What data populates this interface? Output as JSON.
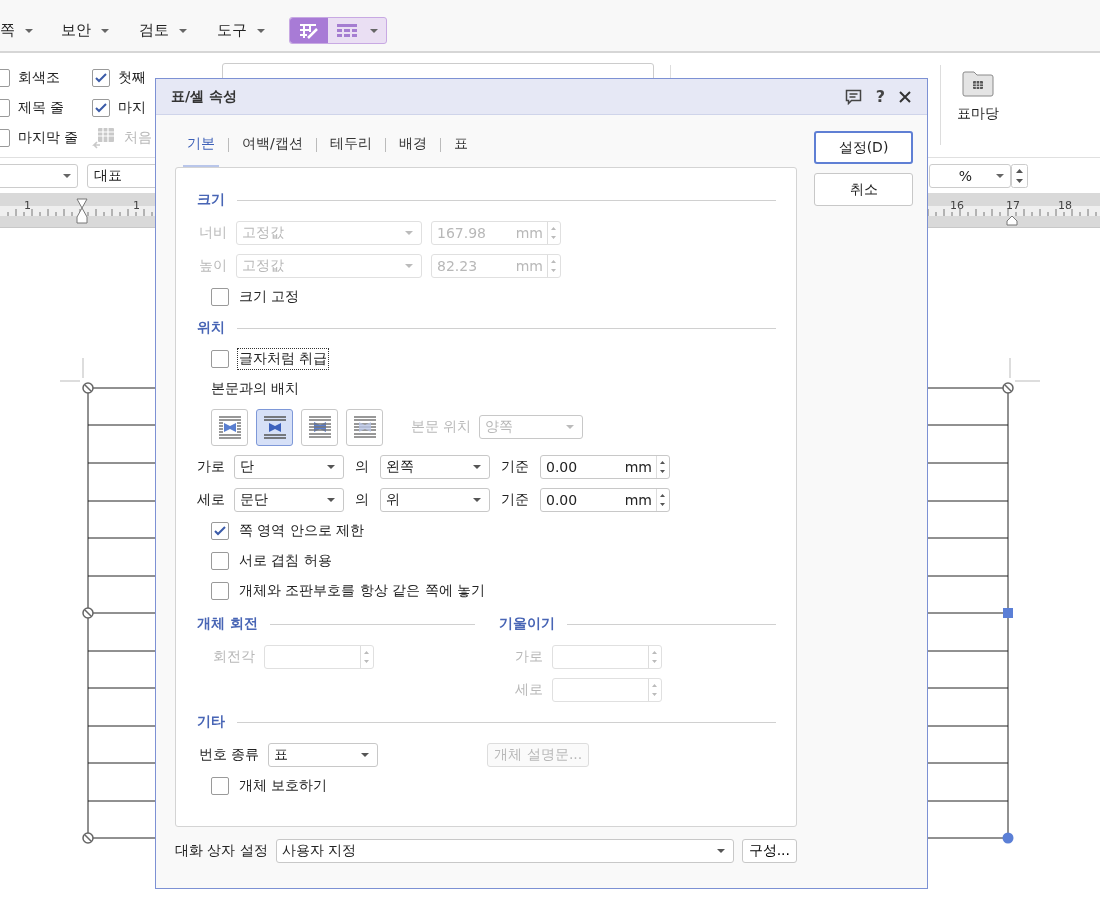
{
  "menu": [
    {
      "label": "쪽"
    },
    {
      "label": "보안"
    },
    {
      "label": "검토"
    },
    {
      "label": "도구"
    }
  ],
  "menu_toggles": [
    {
      "kind": "table_edit",
      "selected": true
    },
    {
      "kind": "table_grid",
      "selected": false
    }
  ],
  "ribbon": {
    "options": [
      {
        "label": "회색조",
        "checked": false
      },
      {
        "label": "제목 줄",
        "checked": false
      },
      {
        "label": "마지막 줄",
        "checked": false
      },
      {
        "label": "첫째",
        "checked": true
      },
      {
        "label": "마지",
        "checked": true
      }
    ],
    "command": {
      "label": "처음",
      "disabled": true
    },
    "gallery_button": {
      "label": "표마당"
    }
  },
  "format_bar": {
    "style_field": "대표",
    "unit": "%"
  },
  "ruler": {
    "labels": [
      "1",
      "1",
      "16",
      "17",
      "18"
    ]
  },
  "dialog": {
    "title": "표/셀 속성",
    "help": "?",
    "tabs": [
      {
        "label": "기본",
        "selected": true
      },
      {
        "label": "여백/캡션",
        "selected": false
      },
      {
        "label": "테두리",
        "selected": false
      },
      {
        "label": "배경",
        "selected": false
      },
      {
        "label": "표",
        "selected": false
      }
    ],
    "buttons": [
      {
        "label": "설정(D)",
        "kind": "default"
      },
      {
        "label": "취소",
        "kind": "normal"
      }
    ],
    "size": {
      "heading": "크기",
      "disabled": true,
      "rows": [
        {
          "label": "너비",
          "mode": "고정값",
          "value": "167.98",
          "unit": "mm"
        },
        {
          "label": "높이",
          "mode": "고정값",
          "value": "82.23",
          "unit": "mm"
        }
      ],
      "lock": {
        "label": "크기 고정",
        "checked": false
      }
    },
    "position": {
      "heading": "위치",
      "treat_as_char": {
        "label": "글자처럼 취급",
        "checked": false,
        "focused": true
      },
      "wrap_label": "본문과의 배치",
      "wrap_options": [
        {
          "kind": "square",
          "selected": false
        },
        {
          "kind": "top_bottom",
          "selected": true
        },
        {
          "kind": "behind",
          "selected": false
        },
        {
          "kind": "front",
          "selected": false
        }
      ],
      "text_side": {
        "label": "본문 위치",
        "value": "양쪽",
        "disabled": true
      },
      "offsets": [
        {
          "label": "가로",
          "relative_to": "단",
          "of": "의",
          "anchor": "왼쪽",
          "basis": "기준",
          "value": "0.00",
          "unit": "mm"
        },
        {
          "label": "세로",
          "relative_to": "문단",
          "of": "의",
          "anchor": "위",
          "basis": "기준",
          "value": "0.00",
          "unit": "mm"
        }
      ],
      "options": [
        {
          "label": "쪽 영역 안으로 제한",
          "checked": true
        },
        {
          "label": "서로 겹침 허용",
          "checked": false
        },
        {
          "label": "개체와 조판부호를 항상 같은 쪽에 놓기",
          "checked": false
        }
      ]
    },
    "rotation": {
      "heading": "개체 회전",
      "disabled": true,
      "fields": [
        {
          "label": "회전각"
        }
      ]
    },
    "skew": {
      "heading": "기울이기",
      "disabled": true,
      "fields": [
        {
          "label": "가로"
        },
        {
          "label": "세로"
        }
      ]
    },
    "other": {
      "heading": "기타",
      "numbering": {
        "label": "번호 종류",
        "value": "표"
      },
      "description_button": {
        "label": "개체 설명문...",
        "disabled": true
      },
      "protect": {
        "label": "개체 보호하기",
        "checked": false
      }
    },
    "footer": {
      "label": "대화 상자 설정",
      "value": "사용자 지정",
      "button": "구성..."
    }
  }
}
